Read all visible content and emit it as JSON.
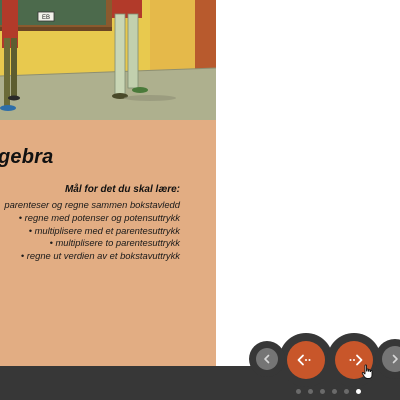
{
  "chapter": {
    "title": "gebra",
    "goals_heading": "Mål for det du skal lære:",
    "goals": [
      "parenteser og regne sammen bokstavledd",
      "• regne med potenser og potensuttrykk",
      "• multiplisere med et parentesuttrykk",
      "• multiplisere to parentesuttrykk",
      "• regne ut verdien av et bokstavuttrykk"
    ]
  },
  "illustration": {
    "sign_text": "EB"
  },
  "navigation": {
    "prev_icon": "chevron-left-icon",
    "back_icon": "arrow-left-dots-icon",
    "forward_icon": "arrow-right-dots-icon",
    "next_icon": "chevron-right-icon",
    "accent_color": "#c8562a",
    "bar_color": "#373737"
  },
  "pager": {
    "page_count": 6,
    "active_index": 5
  }
}
